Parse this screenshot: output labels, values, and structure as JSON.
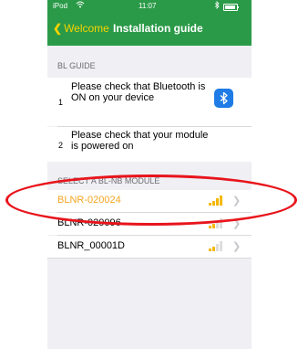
{
  "status_bar": {
    "carrier": "iPod",
    "time": "11:07"
  },
  "nav": {
    "back_label": "Welcome",
    "title": "Installation guide"
  },
  "guide": {
    "header": "BL GUIDE",
    "steps": [
      {
        "number": "1",
        "text": "Please check that Bluetooth is ON on your device"
      },
      {
        "number": "2",
        "text": "Please check that your module is powered on"
      }
    ]
  },
  "modules": {
    "header": "SELECT A BL-NB MODULE",
    "items": [
      {
        "name": "BLNR-020024",
        "selected": true,
        "signal_bars": 4
      },
      {
        "name": "BLNR-020096",
        "selected": false,
        "signal_bars": 2
      },
      {
        "name": "BLNR_00001D",
        "selected": false,
        "signal_bars": 2
      }
    ]
  },
  "colors": {
    "header_green": "#2b9a48",
    "back_yellow": "#f5d300",
    "selected_orange": "#f5a623",
    "bluetooth_blue": "#1f7be5",
    "signal_on": "#f5b800",
    "annotation_red": "#e8141b"
  }
}
